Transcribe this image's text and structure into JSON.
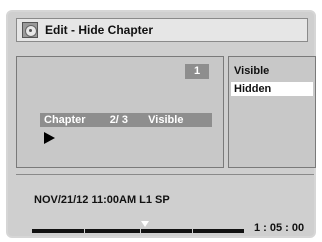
{
  "title_bar": {
    "icon": "disc-icon",
    "title": "Edit - Hide Chapter"
  },
  "preview": {
    "chapter_badge": "1",
    "chapter_label": "Chapter",
    "chapter_position": "2/ 3",
    "chapter_state": "Visible",
    "play_icon": "play-icon"
  },
  "menu": {
    "items": [
      {
        "label": "Visible",
        "selected": false
      },
      {
        "label": "Hidden",
        "selected": true
      }
    ]
  },
  "status": {
    "info": "NOV/21/12 11:00AM L1 SP",
    "time": "1 : 05 : 00",
    "progress_fraction": 0.52
  }
}
